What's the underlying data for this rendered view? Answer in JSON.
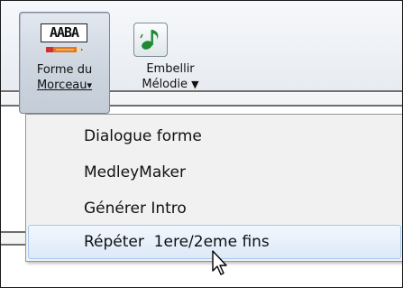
{
  "toolbar": {
    "song_form": {
      "icon_text": "AABA",
      "label_line1": "Forme du",
      "label_line2": "Morceau",
      "dropdown_glyph": "▾",
      "icon": "aaba-form-icon",
      "state": "pressed"
    },
    "embellish": {
      "label_line1": "Embellir",
      "label_line2": "Mélodie",
      "dropdown_glyph": "▼",
      "icon": "music-note-icon"
    }
  },
  "menu": {
    "items": [
      {
        "label": "Dialogue forme"
      },
      {
        "label": "MedleyMaker"
      },
      {
        "label": "Générer Intro"
      },
      {
        "label": "Répéter  1ere/2eme fins",
        "state": "hover"
      }
    ]
  },
  "colors": {
    "highlight_border": "#a8c8ee",
    "note_green": "#1e8a34",
    "pencil_orange": "#e07a1b",
    "pencil_red": "#d0312d"
  }
}
